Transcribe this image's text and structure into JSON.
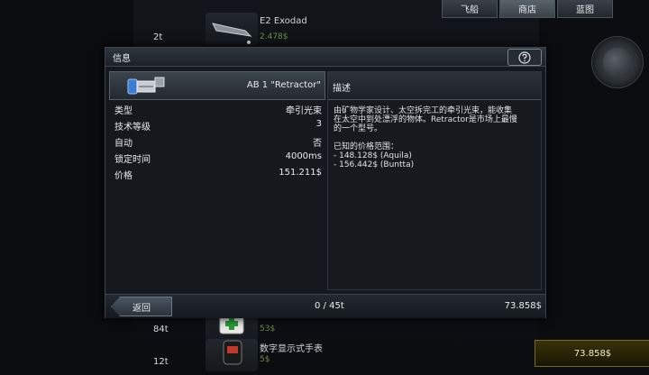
{
  "top_tabs": [
    {
      "label": "飞船"
    },
    {
      "label": "商店"
    },
    {
      "label": "蓝图"
    }
  ],
  "background_list": [
    {
      "qty": "2t",
      "name": "E2 Exodad",
      "price": "2.478$"
    },
    {
      "qty": "84t",
      "name": "",
      "price": "53$"
    },
    {
      "qty": "12t",
      "name": "数字显示式手表",
      "price": "5$"
    }
  ],
  "dialog": {
    "title": "信息",
    "item_name": "AB 1 \"Retractor\"",
    "properties": [
      {
        "label": "类型",
        "value": "牵引光束"
      },
      {
        "label": "技术等级",
        "value": "3"
      },
      {
        "label": "自动",
        "value": "否"
      },
      {
        "label": "锁定时间",
        "value": "4000ms"
      },
      {
        "label": "价格",
        "value": "151.211$"
      }
    ],
    "description": {
      "title": "描述",
      "lines": [
        "由矿物学家设计、太空拆完工的牵引光束，能收集",
        "在太空中到处漂浮的物体。Retractor是市场上最慢",
        "的一个型号。"
      ],
      "prices_title": "已知的价格范围：",
      "price_lines": [
        "- 148.128$ (Aquila)",
        "- 156.442$ (Buntta)"
      ]
    },
    "footer": {
      "back_label": "返回",
      "count": "0 / 45t",
      "money": "73.858$"
    }
  },
  "credits": "73.858$"
}
